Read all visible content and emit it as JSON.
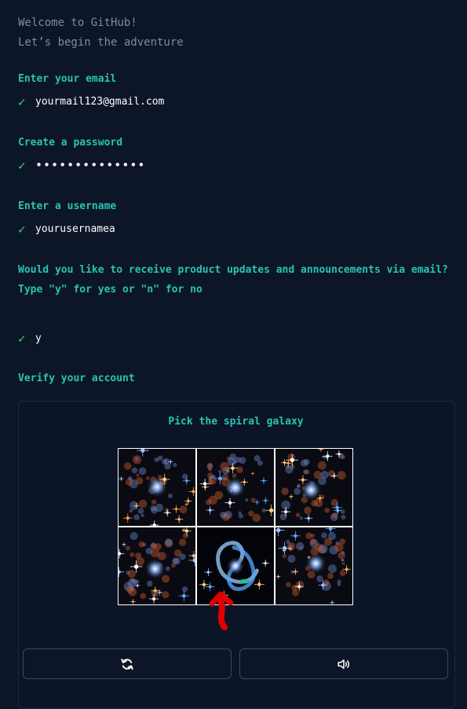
{
  "welcome": {
    "line1": "Welcome to GitHub!",
    "line2": "Let’s begin the adventure"
  },
  "email": {
    "label": "Enter your email",
    "value": "yourmail123@gmail.com"
  },
  "password": {
    "label": "Create a password",
    "value": "••••••••••••••"
  },
  "username": {
    "label": "Enter a username",
    "value": "yourusernamea"
  },
  "updates": {
    "question": "Would you like to receive product updates and announcements via email?",
    "hint": "Type \"y\" for yes or \"n\" for no",
    "value": "y"
  },
  "check_mark": "✓",
  "verify": {
    "label": "Verify your account",
    "captcha_prompt": "Pick the spiral galaxy",
    "tiles": [
      {
        "kind": "cluster"
      },
      {
        "kind": "cluster"
      },
      {
        "kind": "cluster"
      },
      {
        "kind": "cluster"
      },
      {
        "kind": "spiral"
      },
      {
        "kind": "cluster"
      }
    ],
    "refresh_icon": "refresh-icon",
    "audio_icon": "speaker-icon"
  },
  "colors": {
    "background": "#0d1629",
    "accent": "#2ac3b2",
    "check": "#3ecf6e",
    "annotation": "#e00000"
  }
}
